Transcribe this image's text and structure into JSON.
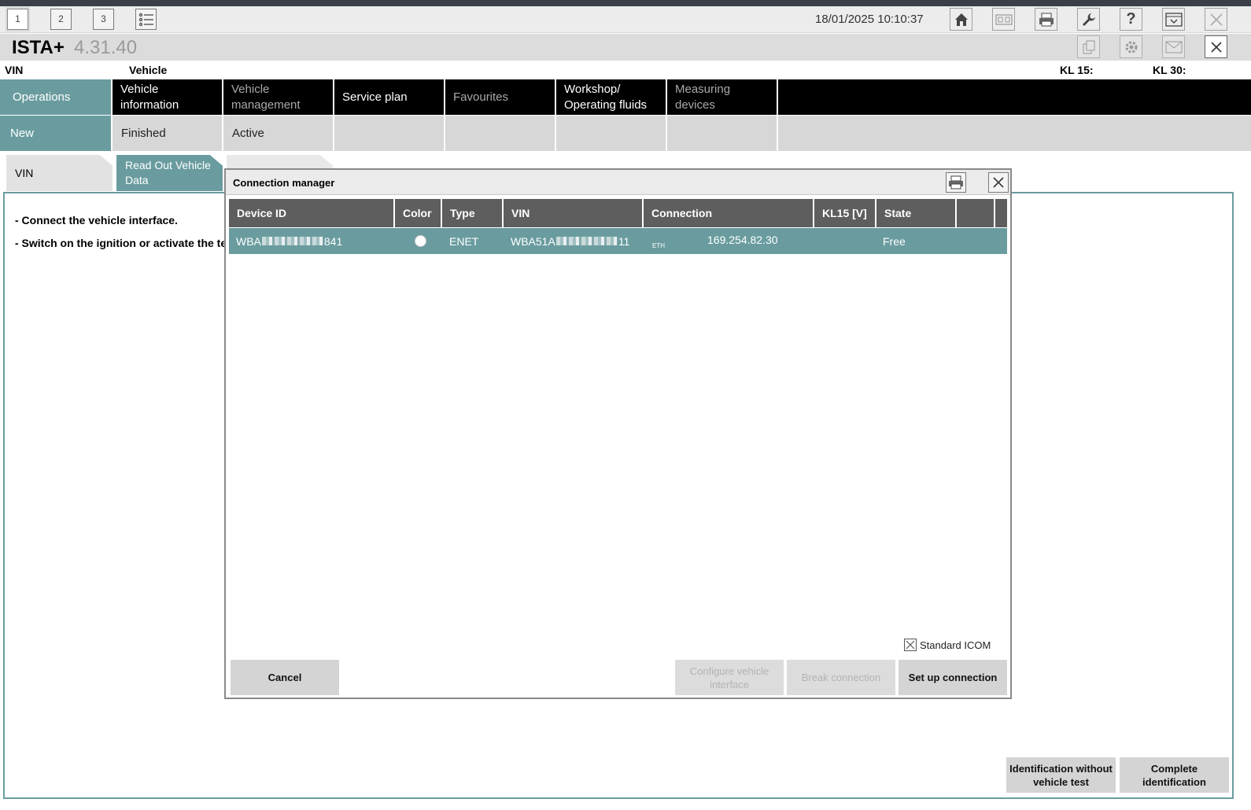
{
  "titlebar": {
    "workspaces": [
      "1",
      "2",
      "3"
    ],
    "datetime": "18/01/2025 10:10:37",
    "icons": [
      "home-icon",
      "dual-view-icon",
      "print-icon",
      "wrench-icon",
      "help-icon",
      "minimize-icon",
      "close-icon"
    ]
  },
  "app": {
    "name": "ISTA+",
    "version": "4.31.40",
    "header_icons": [
      "copy-icon",
      "settings-icon",
      "mail-icon",
      "close-icon"
    ]
  },
  "inforow": {
    "vin_label": "VIN",
    "vehicle_label": "Vehicle",
    "kl15_label": "KL 15:",
    "kl30_label": "KL 30:"
  },
  "mainnav": [
    {
      "label": "Operations",
      "active": true
    },
    {
      "label": "Vehicle information"
    },
    {
      "label": "Vehicle management",
      "dim": true
    },
    {
      "label": "Service plan"
    },
    {
      "label": "Favourites",
      "dim": true
    },
    {
      "label": "Workshop/ Operating fluids"
    },
    {
      "label": "Measuring devices",
      "dim": true
    }
  ],
  "subnav": [
    {
      "label": "New",
      "active": true
    },
    {
      "label": "Finished"
    },
    {
      "label": "Active"
    }
  ],
  "steps": [
    {
      "label": "VIN"
    },
    {
      "label": "Read Out Vehicle Data",
      "active": true
    }
  ],
  "instructions": [
    "- Connect the vehicle interface.",
    "- Switch on the ignition or activate the test"
  ],
  "bottom_buttons": {
    "identify_without_test": "Identification without vehicle test",
    "complete_identification": "Complete identification"
  },
  "dialog": {
    "title": "Connection manager",
    "columns": [
      "Device ID",
      "Color",
      "Type",
      "VIN",
      "Connection",
      "KL15 [V]",
      "State"
    ],
    "rows": [
      {
        "device_id_prefix": "WBA",
        "device_id_suffix": "841",
        "color": "white",
        "type": "ENET",
        "vin_prefix": "WBA51A",
        "vin_suffix": "11",
        "connection_sub": "ETH",
        "connection_ip": "169.254.82.30",
        "kl15": "",
        "state": "Free"
      }
    ],
    "standard_icom_label": "Standard ICOM",
    "standard_icom_checked": true,
    "buttons": {
      "cancel": "Cancel",
      "configure": "Configure vehicle interface",
      "break": "Break connection",
      "setup": "Set up connection"
    }
  },
  "colors": {
    "accent": "#6a9c9f",
    "nav_bg": "#000000",
    "subnav_bg": "#d7d7d7",
    "header_bg": "#5e5e5e"
  }
}
